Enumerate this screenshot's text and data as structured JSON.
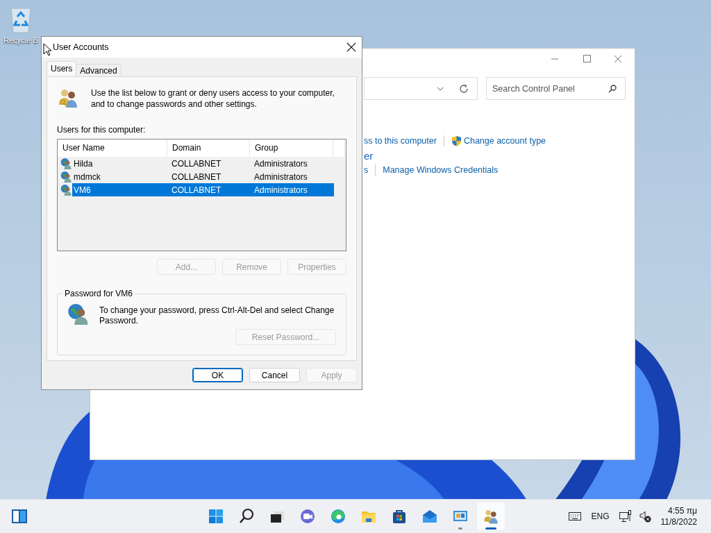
{
  "desktop_icons": [
    {
      "label": "Recycle B"
    }
  ],
  "control_panel_window": {
    "search": {
      "placeholder": "Search Control Panel"
    },
    "links": [
      {
        "text": "ss to this computer",
        "kind": "plain"
      },
      {
        "text": "Change account type",
        "kind": "shield"
      }
    ],
    "heading": "er",
    "links_2": [
      {
        "text": "s",
        "kind": "plain"
      },
      {
        "text": "Manage Windows Credentials",
        "kind": "plain"
      }
    ]
  },
  "dialog": {
    "title": "User Accounts",
    "tabs": [
      {
        "label": "Users",
        "selected": true
      },
      {
        "label": "Advanced",
        "selected": false
      }
    ],
    "intro": "Use the list below to grant or deny users access to your computer, and to change passwords and other settings.",
    "users_label": "Users for this computer:",
    "table": {
      "columns": [
        "User Name",
        "Domain",
        "Group"
      ],
      "rows": [
        {
          "cells": [
            "Hilda",
            "COLLABNET",
            "Administrators"
          ],
          "selected": false
        },
        {
          "cells": [
            "mdmck",
            "COLLABNET",
            "Administrators"
          ],
          "selected": false
        },
        {
          "cells": [
            "VM6",
            "COLLABNET",
            "Administrators"
          ],
          "selected": true
        }
      ]
    },
    "list_buttons": [
      {
        "label": "Add...",
        "disabled": true
      },
      {
        "label": "Remove",
        "disabled": true
      },
      {
        "label": "Properties",
        "disabled": true
      }
    ],
    "password_group": {
      "title": "Password for VM6",
      "text": "To change your password, press Ctrl-Alt-Del and select Change Password.",
      "button": {
        "label": "Reset Password...",
        "disabled": true
      }
    },
    "buttons": [
      {
        "label": "OK",
        "default": true,
        "disabled": false
      },
      {
        "label": "Cancel",
        "default": false,
        "disabled": false
      },
      {
        "label": "Apply",
        "default": false,
        "disabled": true
      }
    ]
  },
  "taskbar": {
    "apps": [
      {
        "kind": "start",
        "running": false,
        "selected": false
      },
      {
        "kind": "search",
        "running": false,
        "selected": false
      },
      {
        "kind": "taskview",
        "running": false,
        "selected": false
      },
      {
        "kind": "chat",
        "running": false,
        "selected": false
      },
      {
        "kind": "browser",
        "running": false,
        "selected": false
      },
      {
        "kind": "folder",
        "running": false,
        "selected": false
      },
      {
        "kind": "store",
        "running": false,
        "selected": false
      },
      {
        "kind": "mail",
        "running": false,
        "selected": false
      },
      {
        "kind": "controlpanel",
        "running": true,
        "selected": false
      },
      {
        "kind": "users",
        "running": true,
        "selected": true
      }
    ],
    "language": "ENG",
    "volume_muted": true,
    "time": "4:55 πμ",
    "date": "11/8/2022"
  }
}
